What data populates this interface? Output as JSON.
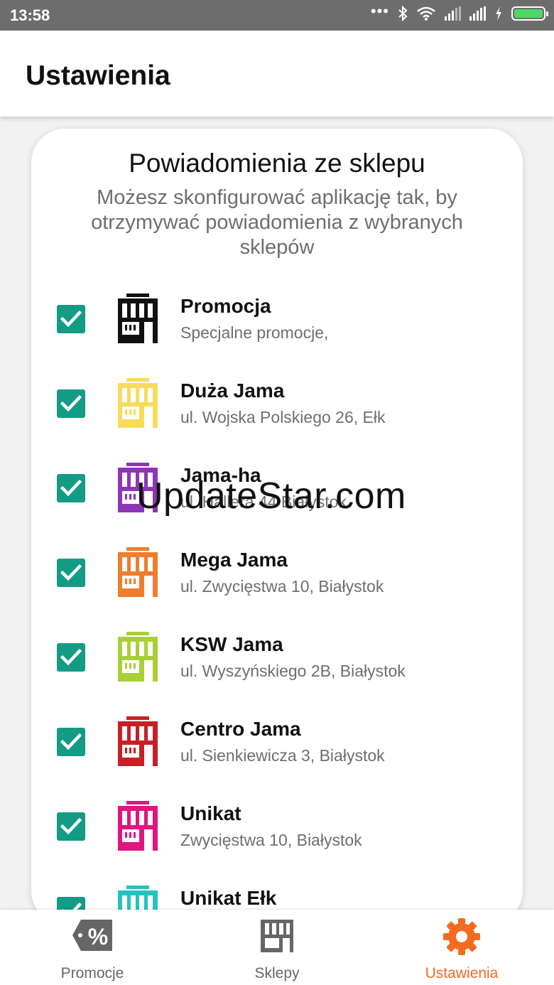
{
  "status_bar": {
    "time": "13:58"
  },
  "header": {
    "title": "Ustawienia"
  },
  "card": {
    "title": "Powiadomienia ze sklepu",
    "description": "Możesz skonfigurować aplikację tak, by otrzymywać powiadomienia z wybranych sklepów"
  },
  "stores": [
    {
      "name": "Promocja",
      "address": "Specjalne promocje,",
      "color": "#111111",
      "checked": true
    },
    {
      "name": "Duża Jama",
      "address": "ul. Wojska Polskiego 26, Ełk",
      "color": "#f7dc5a",
      "checked": true
    },
    {
      "name": "Jama-ha",
      "address": "ul. Hallera 44 Białystok",
      "color": "#8e35b5",
      "checked": true
    },
    {
      "name": "Mega Jama",
      "address": "ul. Zwycięstwa 10, Białystok",
      "color": "#ee7d2c",
      "checked": true
    },
    {
      "name": "KSW Jama",
      "address": "ul. Wyszyńskiego 2B, Białystok",
      "color": "#a9cf38",
      "checked": true
    },
    {
      "name": "Centro Jama",
      "address": "ul. Sienkiewicza 3, Białystok",
      "color": "#c62026",
      "checked": true
    },
    {
      "name": "Unikat",
      "address": "Zwycięstwa 10, Białystok",
      "color": "#e3137f",
      "checked": true
    },
    {
      "name": "Unikat Ełk",
      "address": "",
      "color": "#25c2c0",
      "checked": true
    }
  ],
  "watermark": "UpdateStar.com",
  "bottom_nav": [
    {
      "label": "Promocje",
      "icon": "tag-percent-icon",
      "active": false
    },
    {
      "label": "Sklepy",
      "icon": "store-icon",
      "active": false
    },
    {
      "label": "Ustawienia",
      "icon": "gear-icon",
      "active": true
    }
  ],
  "colors": {
    "accent": "#f26b21",
    "checkbox": "#139b85",
    "status_bar": "#6d6d6d"
  }
}
